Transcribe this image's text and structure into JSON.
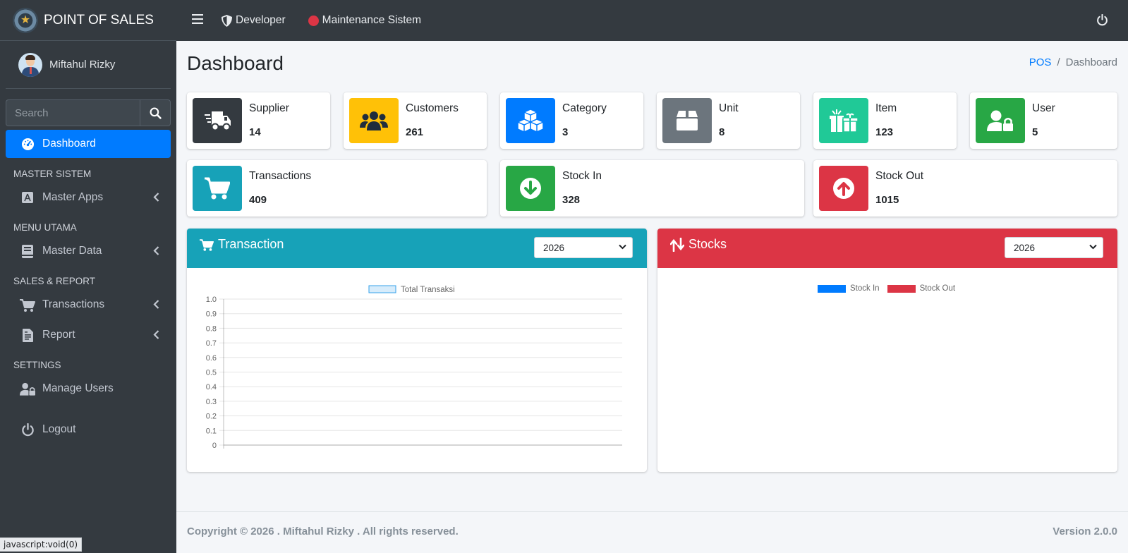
{
  "brand": {
    "title": "POINT OF SALES"
  },
  "user": {
    "name": "Miftahul Rizky"
  },
  "search": {
    "placeholder": "Search"
  },
  "sidebar": {
    "dashboard": "Dashboard",
    "header_master": "MASTER SISTEM",
    "master_apps": "Master Apps",
    "header_menu": "MENU UTAMA",
    "master_data": "Master Data",
    "header_sales": "SALES & REPORT",
    "transactions": "Transactions",
    "report": "Report",
    "header_settings": "SETTINGS",
    "manage_users": "Manage Users",
    "logout": "Logout"
  },
  "navbar": {
    "developer": "Developer",
    "maintenance": "Maintenance Sistem"
  },
  "page": {
    "title": "Dashboard"
  },
  "breadcrumb": {
    "root": "POS",
    "sep": "/",
    "current": "Dashboard"
  },
  "stats": {
    "supplier": {
      "label": "Supplier",
      "value": "14"
    },
    "customers": {
      "label": "Customers",
      "value": "261"
    },
    "category": {
      "label": "Category",
      "value": "3"
    },
    "unit": {
      "label": "Unit",
      "value": "8"
    },
    "item": {
      "label": "Item",
      "value": "123"
    },
    "user": {
      "label": "User",
      "value": "5"
    },
    "transactions": {
      "label": "Transactions",
      "value": "409"
    },
    "stock_in": {
      "label": "Stock In",
      "value": "328"
    },
    "stock_out": {
      "label": "Stock Out",
      "value": "1015"
    }
  },
  "cards": {
    "transaction": {
      "title": "Transaction",
      "year": "2026"
    },
    "stocks": {
      "title": "Stocks",
      "year": "2026"
    }
  },
  "colors": {
    "dark": "#343a40",
    "warning": "#ffc107",
    "primary": "#007bff",
    "secondary": "#6c757d",
    "teal": "#20c997",
    "success": "#28a745",
    "info": "#17a2b8",
    "danger": "#dc3545"
  },
  "chart_data": [
    {
      "type": "line",
      "title": "",
      "series": [
        {
          "name": "Total Transaksi",
          "values": []
        }
      ],
      "ylim": [
        0,
        1.0
      ],
      "yticks": [
        "1.0",
        "0.9",
        "0.8",
        "0.7",
        "0.6",
        "0.5",
        "0.4",
        "0.3",
        "0.2",
        "0.1",
        "0"
      ],
      "grid": true,
      "legend": "top"
    },
    {
      "type": "bar",
      "title": "",
      "series": [
        {
          "name": "Stock In",
          "values": []
        },
        {
          "name": "Stock Out",
          "values": []
        }
      ],
      "legend": "top"
    }
  ],
  "footer": {
    "copyright": "Copyright © 2026 . Miftahul Rizky . All rights reserved.",
    "version": "Version 2.0.0"
  },
  "status": {
    "url": "javascript:void(0)"
  }
}
